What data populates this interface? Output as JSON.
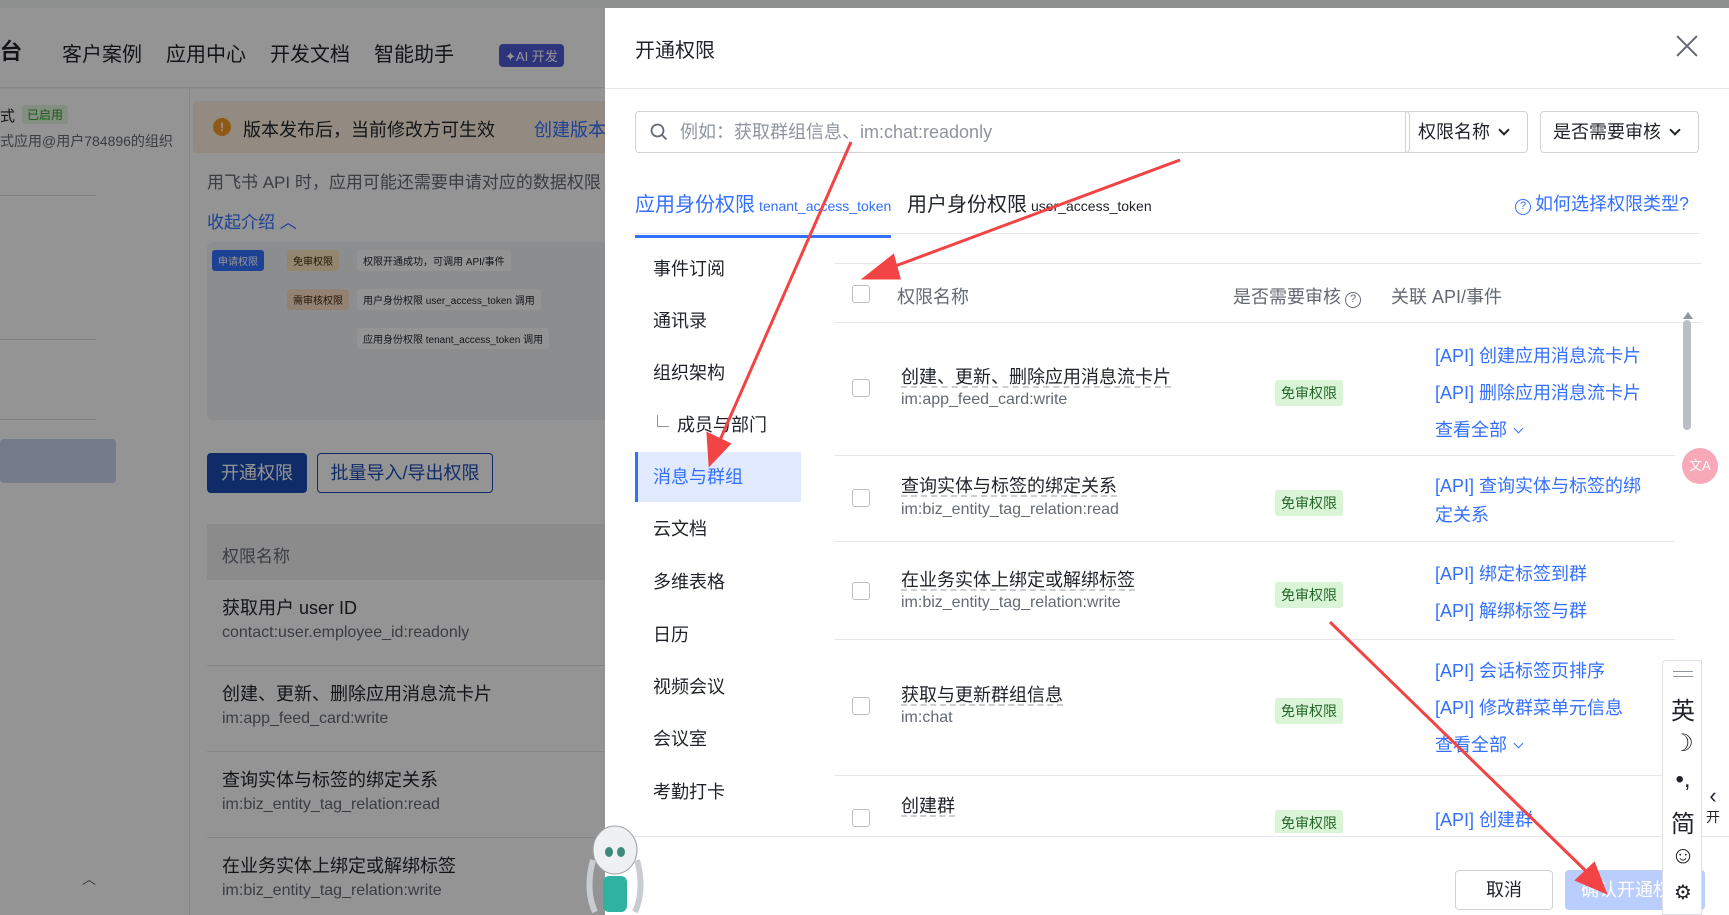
{
  "background": {
    "brand": "台",
    "nav": [
      "客户案例",
      "应用中心",
      "开发文档",
      "智能助手"
    ],
    "ai_badge": "✦AI 开发",
    "app_name_fragment": "式",
    "enabled_badge": "已启用",
    "app_sub": "式应用@用户784896的组织",
    "notice_text": "版本发布后，当前修改方可生效",
    "notice_link": "创建版本",
    "intro_line1": "用飞书 API 时，应用可能还需要申请对应的数据权限",
    "collapse_intro": "收起介绍",
    "flow": {
      "apply": "申请权限",
      "no_review": "免审权限",
      "success": "权限开通成功，可调用 API/事件",
      "need_review": "需审核权限",
      "user_perm": "用户身份权限 user_access_token 调用",
      "app_perm": "应用身份权限 tenant_access_token 调用"
    },
    "btn_open": "开通权限",
    "btn_batch": "批量导入/导出权限",
    "table_header": "权限名称",
    "rows": [
      {
        "name": "获取用户 user ID",
        "code": "contact:user.employee_id:readonly"
      },
      {
        "name": "创建、更新、删除应用消息流卡片",
        "code": "im:app_feed_card:write"
      },
      {
        "name": "查询实体与标签的绑定关系",
        "code": "im:biz_entity_tag_relation:read"
      },
      {
        "name": "在业务实体上绑定或解绑标签",
        "code": "im:biz_entity_tag_relation:write"
      }
    ]
  },
  "drawer": {
    "title": "开通权限",
    "search_placeholder": "例如：获取群组信息、im:chat:readonly",
    "filter_name": "权限名称",
    "filter_review": "是否需要审核",
    "tabs": [
      {
        "main": "应用身份权限",
        "sub": "tenant_access_token"
      },
      {
        "main": "用户身份权限",
        "sub": "user_access_token"
      }
    ],
    "help_link": "如何选择权限类型?",
    "categories": [
      "事件订阅",
      "通讯录",
      "组织架构",
      "成员与部门",
      "消息与群组",
      "云文档",
      "多维表格",
      "日历",
      "视频会议",
      "会议室",
      "考勤打卡"
    ],
    "active_category": "消息与群组",
    "columns": {
      "name": "权限名称",
      "review": "是否需要审核",
      "api": "关联 API/事件"
    },
    "permissions": [
      {
        "name": "创建、更新、删除应用消息流卡片",
        "code": "im:app_feed_card:write",
        "badge": "免审权限",
        "apis": [
          "[API] 创建应用消息流卡片",
          "[API] 删除应用消息流卡片"
        ],
        "more": "查看全部"
      },
      {
        "name": "查询实体与标签的绑定关系",
        "code": "im:biz_entity_tag_relation:read",
        "badge": "免审权限",
        "apis": [
          "[API] 查询实体与标签的绑",
          "定关系"
        ],
        "more": ""
      },
      {
        "name": "在业务实体上绑定或解绑标签",
        "code": "im:biz_entity_tag_relation:write",
        "badge": "免审权限",
        "apis": [
          "[API] 绑定标签到群",
          "[API] 解绑标签与群"
        ],
        "more": ""
      },
      {
        "name": "获取与更新群组信息",
        "code": "im:chat",
        "badge": "免审权限",
        "apis": [
          "[API] 会话标签页排序",
          "[API] 修改群菜单元信息"
        ],
        "more": "查看全部"
      },
      {
        "name": "创建群",
        "code": "",
        "badge": "免审权限",
        "apis": [
          "[API] 创建群"
        ],
        "more": ""
      }
    ],
    "cancel": "取消",
    "confirm": "确认开通权限"
  },
  "ime": {
    "lang": "英",
    "moon": "☽",
    "punct": "•,",
    "simplified": "简",
    "emoji": "☺",
    "settings": "⚙"
  },
  "side_open": "开",
  "side_arrow": "‹",
  "translate_icon": "文A",
  "colors": {
    "primary": "#3370ff",
    "annotation": "#f24444",
    "badge_green": "#d9f5d6"
  }
}
